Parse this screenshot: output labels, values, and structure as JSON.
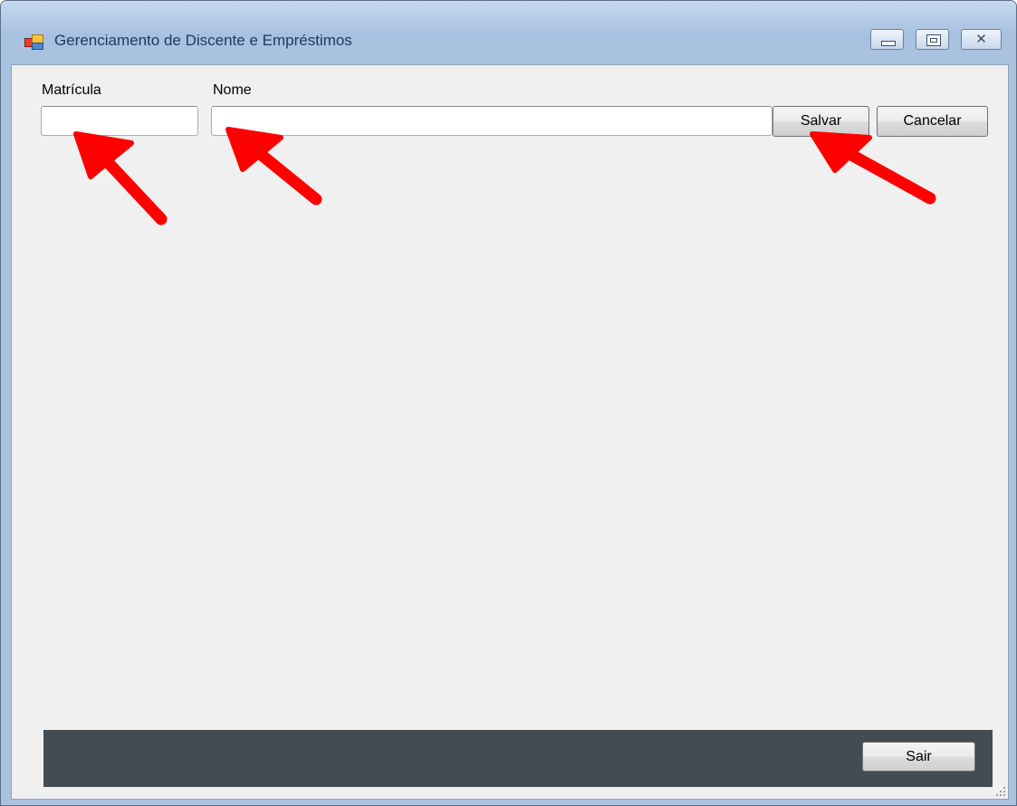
{
  "window": {
    "title": "Gerenciamento de Discente e Empréstimos",
    "icon": "app-icon",
    "controls": {
      "minimize_icon": "minimize-icon",
      "maximize_icon": "maximize-icon",
      "close_icon": "close-icon",
      "close_glyph": "✕"
    }
  },
  "form": {
    "matricula": {
      "label": "Matrícula",
      "value": "",
      "placeholder": ""
    },
    "nome": {
      "label": "Nome",
      "value": "",
      "placeholder": ""
    },
    "salvar_label": "Salvar",
    "cancelar_label": "Cancelar"
  },
  "footer": {
    "sair_label": "Sair"
  },
  "annotations": {
    "arrow_color": "#ff0000",
    "arrow_count": 3
  },
  "colors": {
    "client_bg": "#f0f0f0",
    "footer_bg": "#444c53",
    "title_bar": "#b2c9e6"
  }
}
